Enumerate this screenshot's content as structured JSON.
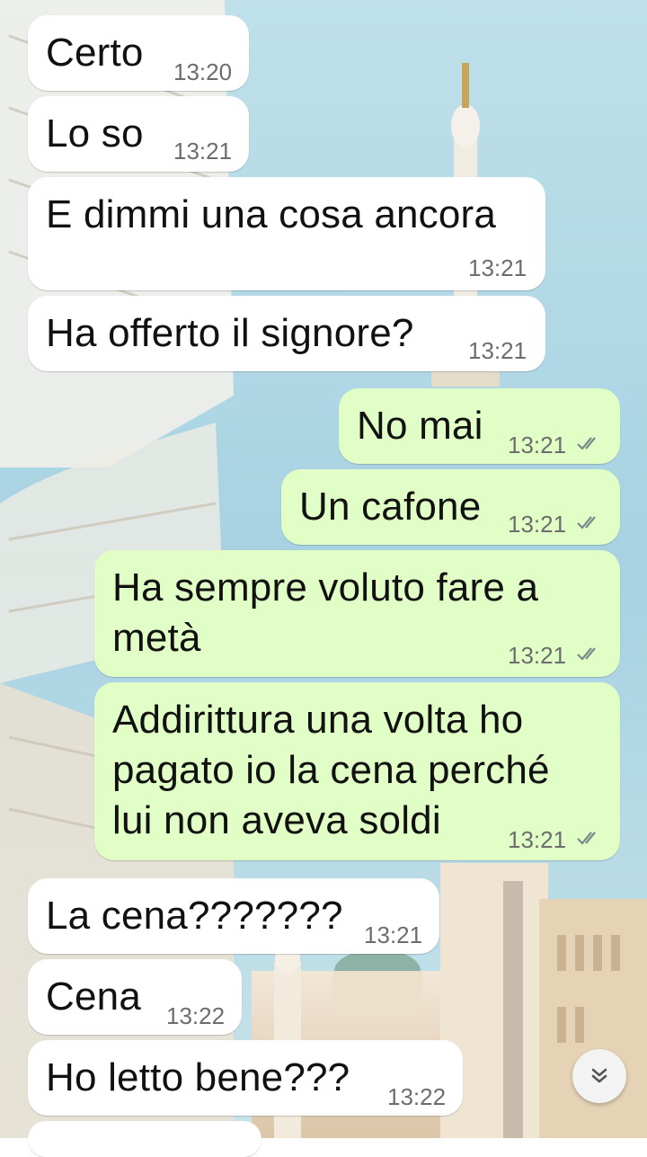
{
  "colors": {
    "incoming_bubble": "#ffffff",
    "outgoing_bubble": "#e1fec6",
    "time_text": "#6d6d6d",
    "tick_read": "#7a8a8a",
    "sky": "#a9d3e3"
  },
  "messages": [
    {
      "direction": "in",
      "text": "Certo",
      "time": "13:20"
    },
    {
      "direction": "in",
      "text": "Lo so",
      "time": "13:21"
    },
    {
      "direction": "in",
      "text": "E dimmi una cosa ancora",
      "time": "13:21"
    },
    {
      "direction": "in",
      "text": "Ha offerto il signore?",
      "time": "13:21"
    },
    {
      "direction": "out",
      "text": "No mai",
      "time": "13:21",
      "status": "double-check-icon"
    },
    {
      "direction": "out",
      "text": "Un cafone",
      "time": "13:21",
      "status": "double-check-icon"
    },
    {
      "direction": "out",
      "text": "Ha sempre voluto fare a\nmetà",
      "time": "13:21",
      "status": "double-check-icon"
    },
    {
      "direction": "out",
      "text": "Addirittura una volta ho\npagato io la cena perché\nlui non aveva soldi",
      "time": "13:21",
      "status": "double-check-icon"
    },
    {
      "direction": "in",
      "text": "La cena???????",
      "time": "13:21"
    },
    {
      "direction": "in",
      "text": "Cena",
      "time": "13:22"
    },
    {
      "direction": "in",
      "text": "Ho letto bene???",
      "time": "13:22"
    }
  ],
  "scroll_button": {
    "icon": "double-chevron-down-icon"
  }
}
